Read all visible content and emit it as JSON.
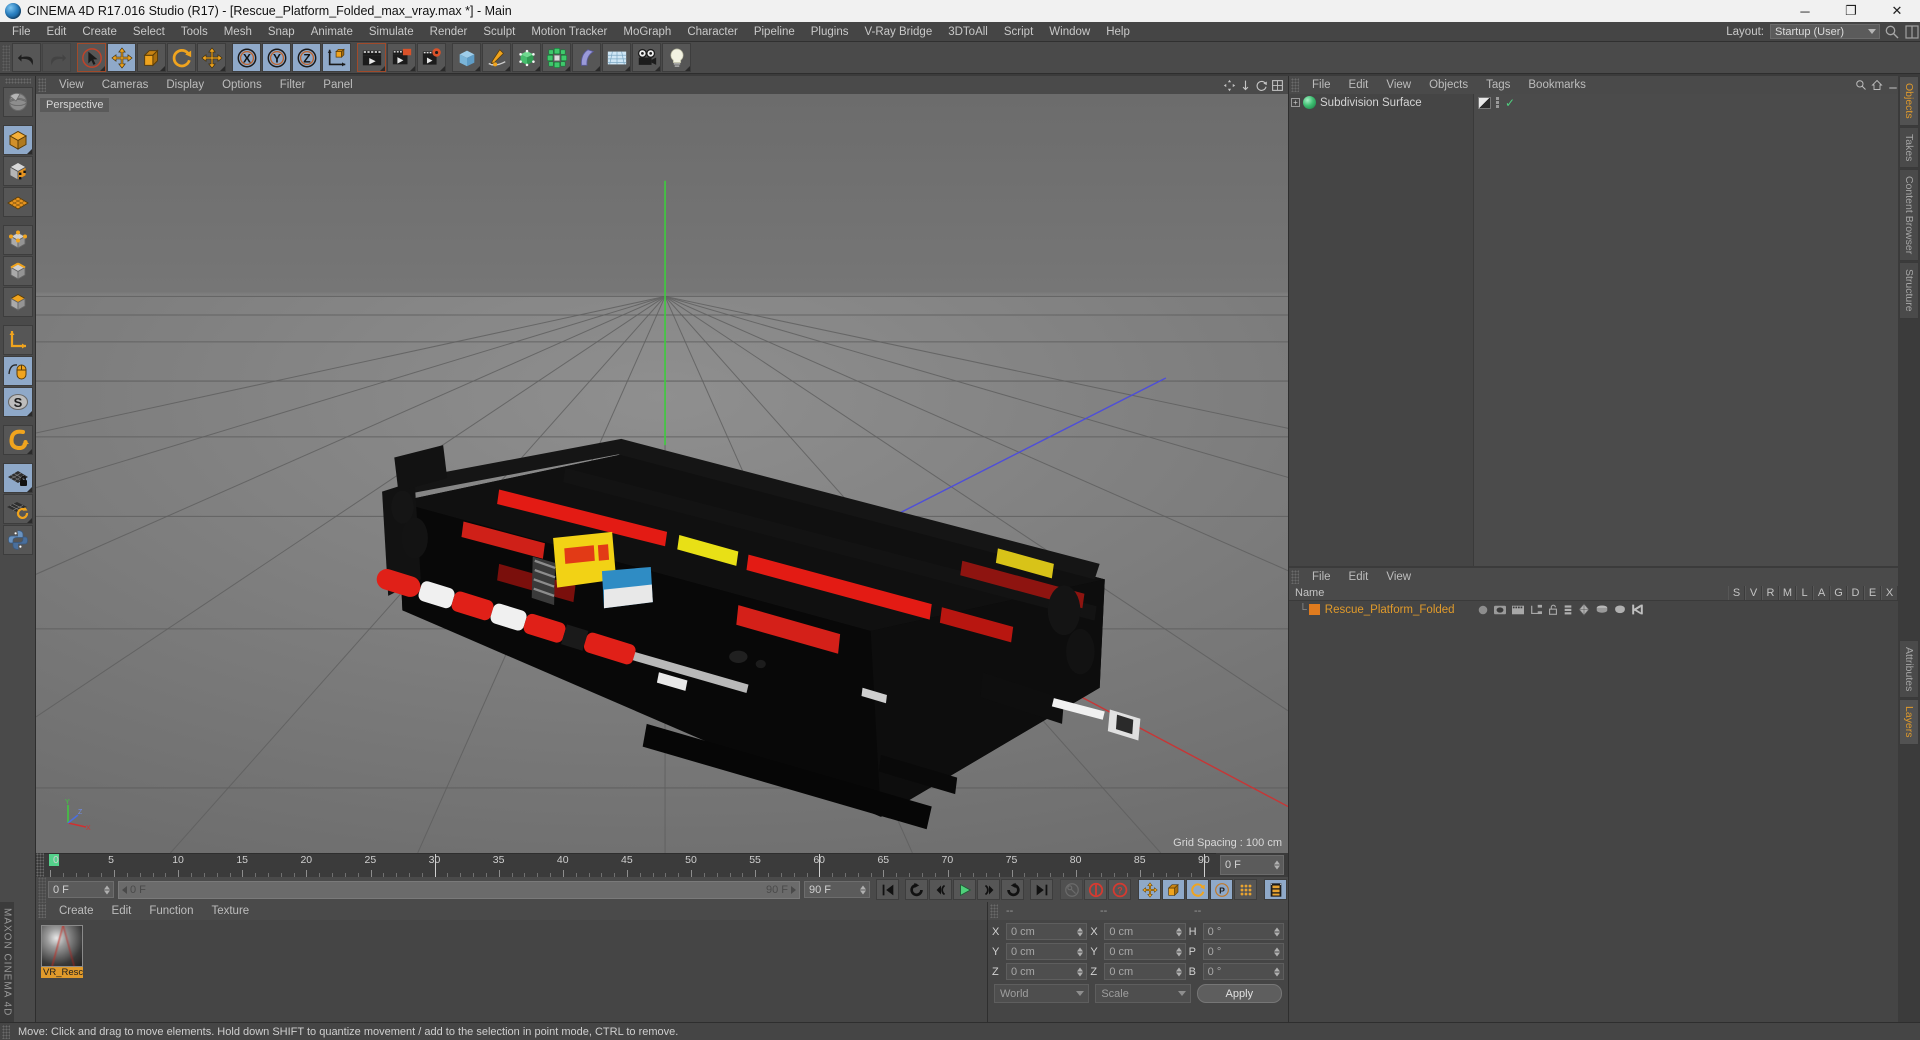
{
  "window": {
    "title": "CINEMA 4D R17.016 Studio (R17) - [Rescue_Platform_Folded_max_vray.max *] - Main",
    "minimize": "─",
    "maximize": "❐",
    "close": "✕"
  },
  "menubar": {
    "items": [
      "File",
      "Edit",
      "Create",
      "Select",
      "Tools",
      "Mesh",
      "Snap",
      "Animate",
      "Simulate",
      "Render",
      "Sculpt",
      "Motion Tracker",
      "MoGraph",
      "Character",
      "Pipeline",
      "Plugins",
      "V-Ray Bridge",
      "3DToAll",
      "Script",
      "Window",
      "Help"
    ],
    "layout_label": "Layout:",
    "layout_value": "Startup (User)"
  },
  "toolbar": {
    "groups": [
      {
        "buttons": [
          {
            "name": "undo-button",
            "icon": "undo-icon",
            "state": "normal"
          },
          {
            "name": "redo-button",
            "icon": "redo-icon",
            "state": "disabled"
          }
        ]
      },
      {
        "buttons": [
          {
            "name": "select-tool-button",
            "icon": "arrow-cursor-icon",
            "state": "highlight"
          },
          {
            "name": "move-tool-button",
            "icon": "move-arrows-icon",
            "state": "active"
          },
          {
            "name": "scale-tool-button",
            "icon": "scale-box-icon",
            "state": "normal"
          },
          {
            "name": "rotate-tool-button",
            "icon": "rotate-circle-icon",
            "state": "normal"
          },
          {
            "name": "axis-move-button",
            "icon": "move-arrows-icon",
            "state": "normal"
          }
        ]
      },
      {
        "buttons": [
          {
            "name": "axis-x-toggle",
            "icon": "x-axis-icon",
            "state": "active"
          },
          {
            "name": "axis-y-toggle",
            "icon": "y-axis-icon",
            "state": "active"
          },
          {
            "name": "axis-z-toggle",
            "icon": "z-axis-icon",
            "state": "active"
          },
          {
            "name": "world-object-coord-button",
            "icon": "world-axis-cube-icon",
            "state": "normal"
          }
        ]
      },
      {
        "buttons": [
          {
            "name": "render-view-button",
            "icon": "clapper-render-icon",
            "state": "highlight"
          },
          {
            "name": "render-region-button",
            "icon": "clapper-picture-icon",
            "state": "normal"
          },
          {
            "name": "render-settings-button",
            "icon": "clapper-gear-icon",
            "state": "normal"
          }
        ]
      },
      {
        "buttons": [
          {
            "name": "add-cube-button",
            "icon": "cube-icon",
            "state": "normal"
          },
          {
            "name": "add-spline-button",
            "icon": "pen-spline-icon",
            "state": "normal"
          },
          {
            "name": "nurbs-button",
            "icon": "green-cube-icon",
            "state": "normal"
          },
          {
            "name": "array-button",
            "icon": "green-cluster-icon",
            "state": "normal"
          },
          {
            "name": "bend-deformer-button",
            "icon": "bend-shape-icon",
            "state": "normal"
          },
          {
            "name": "floor-environment-button",
            "icon": "floor-grid-icon",
            "state": "normal"
          },
          {
            "name": "camera-button",
            "icon": "camera-icon",
            "state": "normal"
          },
          {
            "name": "light-button",
            "icon": "lightbulb-icon",
            "state": "normal"
          }
        ]
      }
    ]
  },
  "left_toolbar": {
    "buttons": [
      {
        "name": "live-selection-button",
        "icon": "globe-selection-icon",
        "state": "normal"
      },
      {
        "name": "model-mode-button",
        "icon": "orange-cube-icon",
        "state": "active"
      },
      {
        "name": "texture-mode-button",
        "icon": "checker-cube-icon",
        "state": "normal"
      },
      {
        "name": "workplane-mode-button",
        "icon": "orange-grid-icon",
        "state": "normal"
      },
      {
        "name": "points-mode-button",
        "icon": "points-cube-icon",
        "state": "normal"
      },
      {
        "name": "edges-mode-button",
        "icon": "edges-cube-icon",
        "state": "normal"
      },
      {
        "name": "polygons-mode-button",
        "icon": "polygon-cube-icon",
        "state": "normal"
      },
      {
        "name": "axis-mode-button",
        "icon": "axis-corner-icon",
        "state": "normal"
      },
      {
        "name": "viewport-solo-button",
        "icon": "mouse-spline-icon",
        "state": "active"
      },
      {
        "name": "snapping-button",
        "icon": "s-disc-icon",
        "state": "active"
      },
      {
        "name": "magnet-button",
        "icon": "magnet-icon",
        "state": "normal"
      },
      {
        "name": "workplane-lock-button",
        "icon": "grid-lock-icon",
        "state": "active"
      },
      {
        "name": "workplane-rotate-button",
        "icon": "grid-rotate-icon",
        "state": "normal"
      },
      {
        "name": "python-button",
        "icon": "python-snake-icon",
        "state": "normal"
      }
    ]
  },
  "viewport": {
    "menu": [
      "View",
      "Cameras",
      "Display",
      "Options",
      "Filter",
      "Panel"
    ],
    "label": "Perspective",
    "grid_spacing": "Grid Spacing : 100 cm",
    "axis": {
      "x": "X",
      "y": "Y",
      "z": "Z"
    },
    "scene_object": "Rescue_Platform_Folded"
  },
  "timeline": {
    "ticks": [
      0,
      5,
      10,
      15,
      20,
      25,
      30,
      35,
      40,
      45,
      50,
      55,
      60,
      65,
      70,
      75,
      80,
      85,
      90
    ],
    "start": 0,
    "end": 90,
    "current_frame_label": "0 F",
    "end_frame_label": "90 F",
    "playhead_frame": 0
  },
  "playback": {
    "current_frame": "0 F",
    "range_start": "0 F",
    "range_end": "90 F",
    "max_frame": "90 F",
    "buttons": [
      {
        "name": "goto-start-button",
        "icon": "skip-start-icon",
        "state": "normal"
      },
      {
        "name": "play-backwards-button",
        "icon": "reverse-loop-icon",
        "state": "normal"
      },
      {
        "name": "previous-frame-button",
        "icon": "step-back-icon",
        "state": "normal"
      },
      {
        "name": "play-button",
        "icon": "play-icon",
        "state": "normal"
      },
      {
        "name": "next-frame-button",
        "icon": "step-forward-icon",
        "state": "normal"
      },
      {
        "name": "play-forwards-button",
        "icon": "forward-loop-icon",
        "state": "normal"
      },
      {
        "name": "goto-end-button",
        "icon": "skip-end-icon",
        "state": "normal"
      },
      {
        "name": "record-keys-button",
        "icon": "key-icon",
        "state": "disabled"
      },
      {
        "name": "autokey-button",
        "icon": "record-circle-icon",
        "state": "normal"
      },
      {
        "name": "keyframe-help-button",
        "icon": "question-circle-icon",
        "state": "normal"
      },
      {
        "name": "key-position-button",
        "icon": "move-arrows-icon",
        "state": "active"
      },
      {
        "name": "key-scale-button",
        "icon": "scale-box-icon",
        "state": "active"
      },
      {
        "name": "key-rotation-button",
        "icon": "rotate-circle-icon",
        "state": "active"
      },
      {
        "name": "key-param-button",
        "icon": "p-circle-icon",
        "state": "active"
      },
      {
        "name": "key-pla-button",
        "icon": "dots-grid-icon",
        "state": "normal"
      },
      {
        "name": "timeline-window-button",
        "icon": "filmstrip-icon",
        "state": "active"
      }
    ]
  },
  "material_manager": {
    "menu": [
      "Create",
      "Edit",
      "Function",
      "Texture"
    ],
    "materials": [
      {
        "name": "VR_Resc",
        "selected": true
      }
    ]
  },
  "coordinates": {
    "headers": [
      "--",
      "--",
      "--"
    ],
    "rows": [
      {
        "label1": "X",
        "value1": "0 cm",
        "label2": "X",
        "value2": "0 cm",
        "label3": "H",
        "value3": "0 °"
      },
      {
        "label1": "Y",
        "value1": "0 cm",
        "label2": "Y",
        "value2": "0 cm",
        "label3": "P",
        "value3": "0 °"
      },
      {
        "label1": "Z",
        "value1": "0 cm",
        "label2": "Z",
        "value2": "0 cm",
        "label3": "B",
        "value3": "0 °"
      }
    ],
    "system": "World",
    "mode": "Scale",
    "apply": "Apply"
  },
  "object_manager": {
    "menu": [
      "File",
      "Edit",
      "View",
      "Objects",
      "Tags",
      "Bookmarks"
    ],
    "tree": [
      {
        "label": "Subdivision Surface",
        "expandable": true,
        "has_tag": true,
        "checked": true
      }
    ]
  },
  "object_manager_2": {
    "menu": [
      "File",
      "Edit",
      "View"
    ],
    "name_header": "Name",
    "columns": [
      "S",
      "V",
      "R",
      "M",
      "L",
      "A",
      "G",
      "D",
      "E",
      "X"
    ],
    "rows": [
      {
        "name": "Rescue_Platform_Folded",
        "color": "#e09a2b"
      }
    ]
  },
  "right_tabs": {
    "upper": [
      "Objects",
      "Takes",
      "Content Browser",
      "Structure"
    ],
    "lower": [
      "Attributes",
      "Layers"
    ],
    "active_upper": "Objects",
    "active_lower": "Layers"
  },
  "brand": "MAXON CINEMA 4D",
  "statusbar": {
    "message": "Move: Click and drag to move elements. Hold down SHIFT to quantize movement / add to the selection in point mode, CTRL to remove."
  },
  "colors": {
    "accent_orange": "#e09a2b",
    "active_blue": "#8fa9c9",
    "panel_bg": "#454545",
    "toolbar_bg": "#4a4a4a",
    "viewport_bg": "#7d7d7d"
  }
}
